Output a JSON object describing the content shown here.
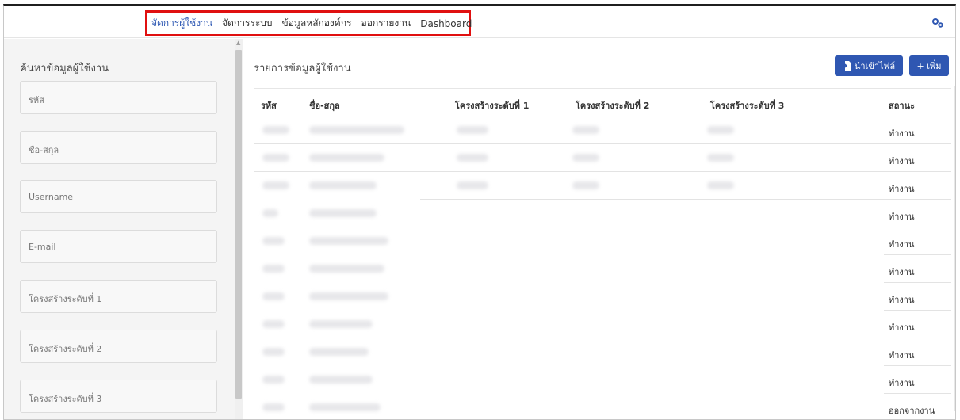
{
  "topnav": {
    "items": [
      {
        "label": "จัดการผู้ใช้งาน",
        "active": true
      },
      {
        "label": "จัดการระบบ"
      },
      {
        "label": "ข้อมูลหลักองค์กร"
      },
      {
        "label": "ออกรายงาน"
      },
      {
        "label": "Dashboard"
      }
    ],
    "settings_icon": "gears-icon"
  },
  "sidebar": {
    "title": "ค้นหาข้อมูลผู้ใช้งาน",
    "fields": [
      {
        "placeholder": "รหัส"
      },
      {
        "placeholder": "ชื่อ-สกุล"
      },
      {
        "placeholder": "Username"
      },
      {
        "placeholder": "E-mail"
      },
      {
        "placeholder": "โครงสร้างระดับที่ 1"
      },
      {
        "placeholder": "โครงสร้างระดับที่ 2"
      },
      {
        "placeholder": "โครงสร้างระดับที่ 3"
      }
    ]
  },
  "main": {
    "title": "รายการข้อมูลผู้ใช้งาน",
    "import_label": "นำเข้าไฟล์",
    "add_label": "+ เพิ่ม",
    "columns": [
      "รหัส",
      "ชื่อ-สกุล",
      "โครงสร้างระดับที่ 1",
      "โครงสร้างระดับที่ 2",
      "โครงสร้างระดับที่ 3",
      "สถานะ"
    ],
    "rows": [
      {
        "status": "ทำงาน"
      },
      {
        "status": "ทำงาน"
      },
      {
        "status": "ทำงาน"
      },
      {
        "status": "ทำงาน"
      },
      {
        "status": "ทำงาน"
      },
      {
        "status": "ทำงาน"
      },
      {
        "status": "ทำงาน"
      },
      {
        "status": "ทำงาน"
      },
      {
        "status": "ทำงาน"
      },
      {
        "status": "ทำงาน"
      },
      {
        "status": "ออกจากงาน"
      }
    ]
  },
  "colors": {
    "accent": "#2f57b2",
    "nav_highlight": "#e01010"
  }
}
